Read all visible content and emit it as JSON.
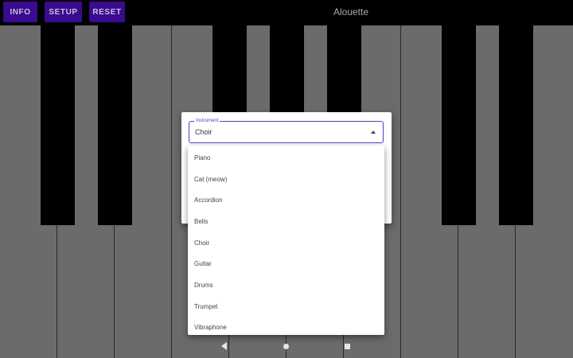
{
  "toolbar": {
    "info_label": "INFO",
    "setup_label": "SETUP",
    "reset_label": "RESET",
    "title": "Alouette"
  },
  "dialog": {
    "field_label": "Instrument",
    "selected_value": "Choir"
  },
  "menu": {
    "options": [
      "Piano",
      "Cat (meow)",
      "Accordion",
      "Bells",
      "Choir",
      "Guitar",
      "Drums",
      "Trumpet",
      "Vibraphone"
    ]
  },
  "colors": {
    "button_bg": "#3a0a8f",
    "accent": "#5b3cc4",
    "white_key": "#6b6b6b",
    "black_key": "#000000"
  },
  "navbar": {
    "icons": [
      "back-icon",
      "home-icon",
      "recents-icon"
    ]
  }
}
